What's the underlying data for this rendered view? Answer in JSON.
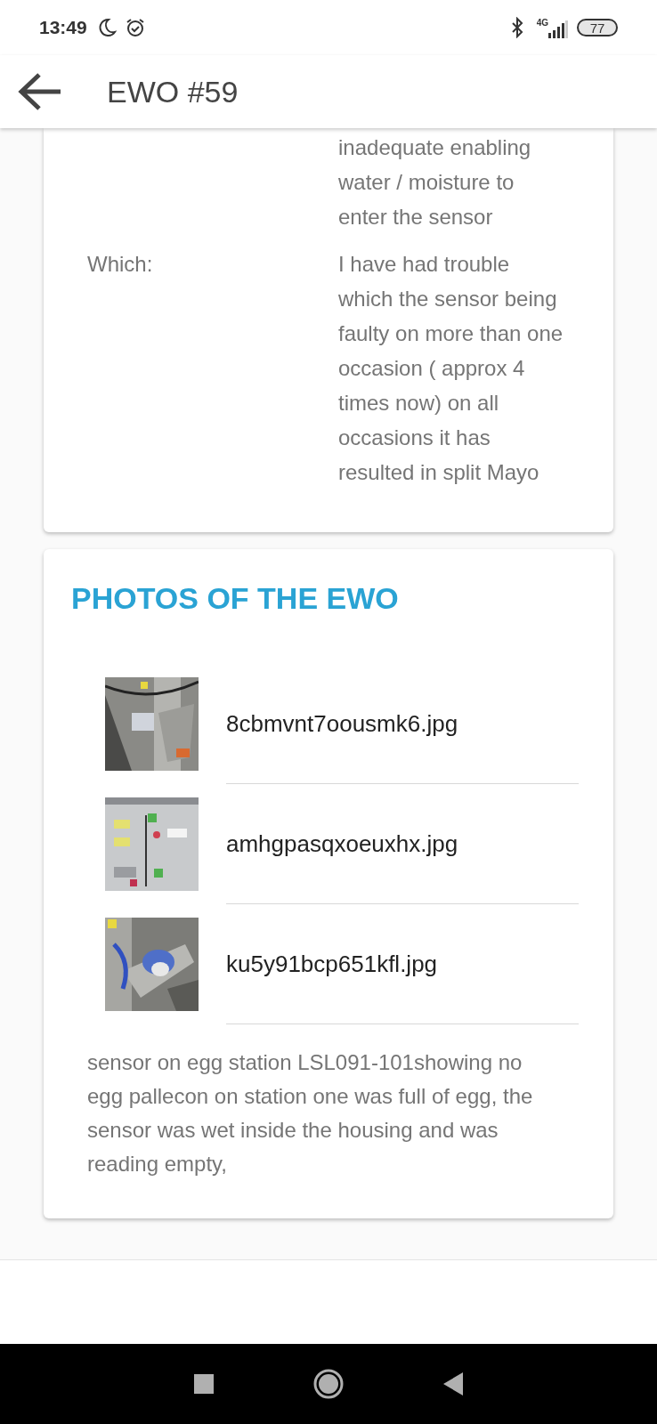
{
  "status_bar": {
    "time": "13:49",
    "network": "4G",
    "battery": "77"
  },
  "app_bar": {
    "title": "EWO #59"
  },
  "details": [
    {
      "value": "inadequate enabling water / moisture to enter the sensor"
    },
    {
      "label": "Which:",
      "value": "I have had trouble which the sensor being faulty on more than one occasion ( approx 4 times now) on all occasions it has resulted in split Mayo"
    }
  ],
  "photos": {
    "title": "PHOTOS OF THE EWO",
    "files": [
      {
        "name": "8cbmvnt7oousmk6.jpg",
        "kind": "picture"
      },
      {
        "name": "amhgpasqxoeuxhx.jpg",
        "kind": "picture"
      },
      {
        "name": "ku5y91bcp651kfl.jpg",
        "kind": "picture"
      }
    ],
    "description": "sensor on egg station LSL091-101showing no egg pallecon on station one was full of egg, the sensor was wet inside the housing and was reading empty,"
  }
}
